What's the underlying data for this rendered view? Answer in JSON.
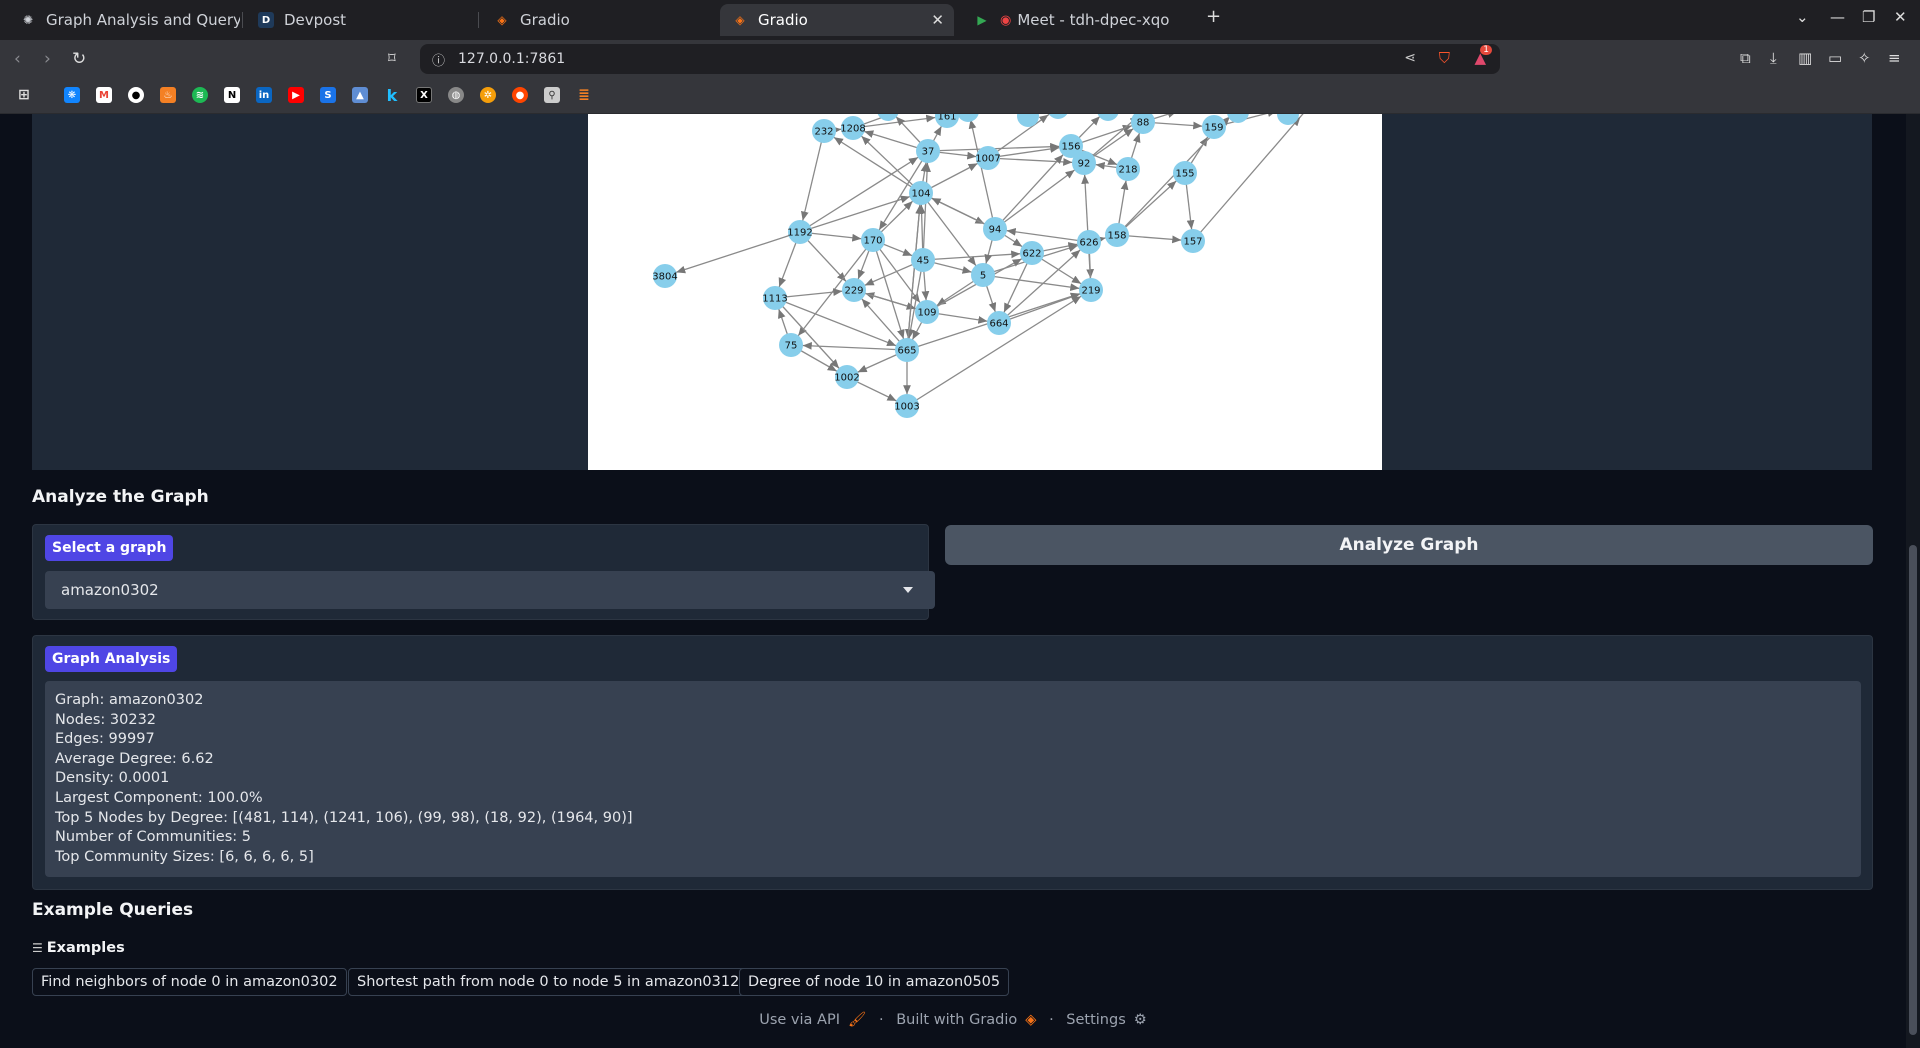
{
  "browser": {
    "tabs": [
      {
        "title": "Graph Analysis and Query Sy",
        "icon": "openai-icon",
        "active": false
      },
      {
        "title": "Devpost",
        "icon": "devpost-icon",
        "active": false
      },
      {
        "title": "Gradio",
        "icon": "gradio-icon",
        "active": false
      },
      {
        "title": "Gradio",
        "icon": "gradio-icon",
        "active": true
      },
      {
        "title": "Meet - tdh-dpec-xqo",
        "icon": "meet-icon",
        "active": false
      }
    ],
    "url": "127.0.0.1:7861",
    "shield_badge": "1"
  },
  "graph_plot": {
    "nodes": [
      "161",
      "232",
      "1208",
      "88",
      "159",
      "37",
      "1007",
      "156",
      "92",
      "218",
      "155",
      "104",
      "94",
      "1192",
      "170",
      "626",
      "158",
      "157",
      "45",
      "622",
      "3804",
      "5",
      "229",
      "1113",
      "219",
      "109",
      "664",
      "75",
      "665",
      "1002",
      "1003"
    ]
  },
  "analyze": {
    "section_title": "Analyze the Graph",
    "select_label": "Select a graph",
    "selected_graph": "amazon0302",
    "button_label": "Analyze Graph"
  },
  "analysis": {
    "label": "Graph Analysis",
    "lines": [
      "Graph: amazon0302",
      "Nodes: 30232",
      "Edges: 99997",
      "Average Degree: 6.62",
      "Density: 0.0001",
      "Largest Component: 100.0%",
      "Top 5 Nodes by Degree: [(481, 114), (1241, 106), (99, 98), (18, 92), (1964, 90)]",
      "Number of Communities: 5",
      "Top Community Sizes: [6, 6, 6, 6, 5]"
    ]
  },
  "examples": {
    "section_title": "Example Queries",
    "label": "Examples",
    "items": [
      "Find neighbors of node 0 in amazon0302",
      "Shortest path from node 0 to node 5 in amazon0312",
      "Degree of node 10 in amazon0505"
    ]
  },
  "footer": {
    "api": "Use via API",
    "built": "Built with Gradio",
    "settings": "Settings",
    "dot": "·"
  }
}
